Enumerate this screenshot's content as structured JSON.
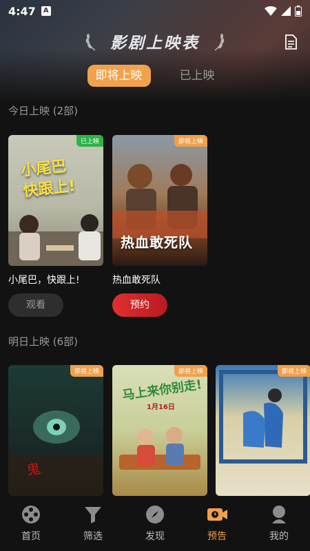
{
  "status": {
    "time": "4:47",
    "a_label": "A"
  },
  "header": {
    "title": "影剧上映表"
  },
  "tabs": [
    {
      "label": "即将上映",
      "active": true
    },
    {
      "label": "已上映",
      "active": false
    }
  ],
  "today": {
    "label": "今日上映 (2部)",
    "movies": [
      {
        "title": "小尾巴，快跟上!",
        "badge": "已上映",
        "poster_text": "小尾巴\n快跟上!",
        "action": "观看"
      },
      {
        "title": "热血敢死队",
        "badge": "即将上映",
        "poster_text": "热血敢死队",
        "action": "预约"
      }
    ]
  },
  "tomorrow": {
    "label": "明日上映 (6部)",
    "movies": [
      {
        "badge": "即将上映"
      },
      {
        "badge": "即将上映",
        "poster_text": "马上来你别走!",
        "poster_date": "1月16日"
      },
      {
        "badge": "即将上映"
      }
    ]
  },
  "nav": [
    {
      "label": "首页",
      "icon": "film-reel-icon"
    },
    {
      "label": "筛选",
      "icon": "funnel-icon"
    },
    {
      "label": "发现",
      "icon": "compass-icon"
    },
    {
      "label": "预告",
      "icon": "video-camera-icon",
      "active": true
    },
    {
      "label": "我的",
      "icon": "user-icon"
    }
  ],
  "colors": {
    "accent": "#f0a04a",
    "reserve": "#d8262a",
    "released_badge": "#2db34a"
  }
}
